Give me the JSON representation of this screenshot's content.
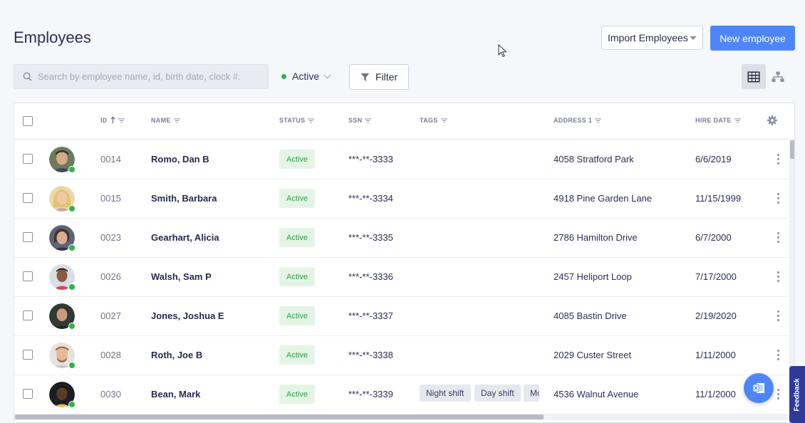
{
  "header": {
    "title": "Employees",
    "import_label": "Import Employees",
    "new_label": "New employee"
  },
  "toolbar": {
    "search_placeholder": "Search by employee name, id, birth date, clock #.",
    "status_filter": "Active",
    "filter_label": "Filter"
  },
  "table": {
    "columns": [
      "ID",
      "NAME",
      "STATUS",
      "SSN",
      "TAGS",
      "ADDRESS 1",
      "HIRE DATE"
    ],
    "rows": [
      {
        "id": "0014",
        "name": "Romo, Dan B",
        "status": "Active",
        "ssn": "***-**-3333",
        "tags": [],
        "address": "4058 Stratford Park",
        "hire_date": "6/6/2019"
      },
      {
        "id": "0015",
        "name": "Smith, Barbara",
        "status": "Active",
        "ssn": "***-**-3334",
        "tags": [],
        "address": "4918 Pine Garden Lane",
        "hire_date": "11/15/1999"
      },
      {
        "id": "0023",
        "name": "Gearhart, Alicia",
        "status": "Active",
        "ssn": "***-**-3335",
        "tags": [],
        "address": "2786 Hamilton Drive",
        "hire_date": "6/7/2000"
      },
      {
        "id": "0026",
        "name": "Walsh, Sam P",
        "status": "Active",
        "ssn": "***-**-3336",
        "tags": [],
        "address": "2457 Heliport Loop",
        "hire_date": "7/17/2000"
      },
      {
        "id": "0027",
        "name": "Jones, Joshua E",
        "status": "Active",
        "ssn": "***-**-3337",
        "tags": [],
        "address": "4085 Bastin Drive",
        "hire_date": "2/19/2020"
      },
      {
        "id": "0028",
        "name": "Roth, Joe B",
        "status": "Active",
        "ssn": "***-**-3338",
        "tags": [],
        "address": "2029 Custer Street",
        "hire_date": "1/11/2000"
      },
      {
        "id": "0030",
        "name": "Bean, Mark",
        "status": "Active",
        "ssn": "***-**-3339",
        "tags": [
          "Night shift",
          "Day shift",
          "Mon"
        ],
        "address": "4536 Walnut Avenue",
        "hire_date": "11/1/2000"
      }
    ]
  },
  "feedback_label": "Feedback",
  "colors": {
    "accent": "#4e86f7",
    "active_text": "#2fa046",
    "active_bg": "#e4f5e6",
    "online": "#2fb44a",
    "feedback_bg": "#2e3a9a"
  },
  "icons": [
    "search-icon",
    "filter-icon",
    "grid-view-icon",
    "org-chart-icon",
    "settings-gear-icon",
    "kebab-menu-icon",
    "sort-arrow-up-icon",
    "column-filter-icon",
    "excel-export-icon",
    "mouse-cursor-icon"
  ]
}
